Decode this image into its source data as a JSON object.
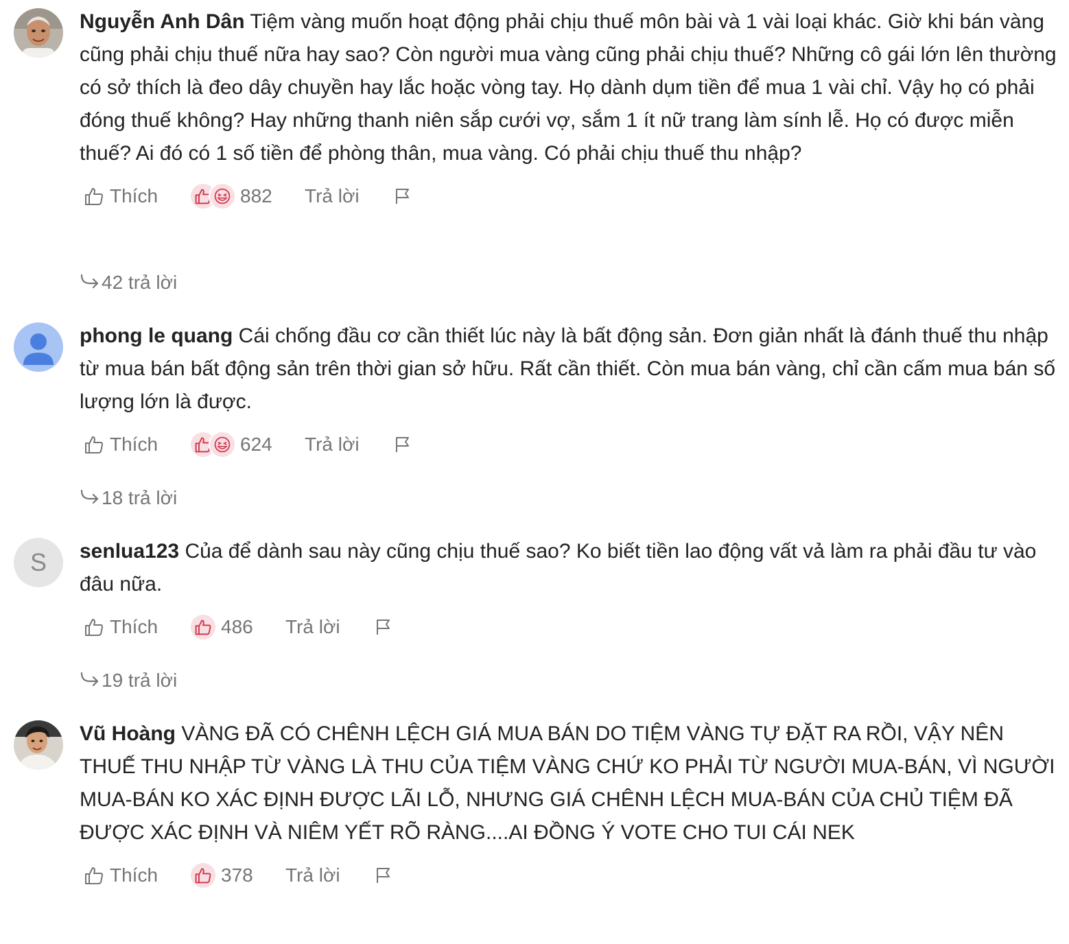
{
  "comments": [
    {
      "author": "Nguyễn Anh Dân",
      "avatar_type": "photo",
      "text": "Tiệm vàng muốn hoạt động phải chịu thuế môn bài và 1 vài loại khác. Giờ khi bán vàng cũng phải chịu thuế nữa hay sao? Còn người mua vàng cũng phải chịu thuế? Những cô gái lớn lên thường có sở thích là đeo dây chuyền hay lắc hoặc vòng tay. Họ dành dụm tiền để mua 1 vài chỉ. Vậy họ có phải đóng thuế không? Hay những thanh niên sắp cưới vợ, sắm 1 ít nữ trang làm sính lễ. Họ có được miễn thuế? Ai đó có 1 số tiền để phòng thân, mua vàng. Có phải chịu thuế thu nhập?",
      "like_label": "Thích",
      "reaction_icons": [
        "thumbs-up-icon",
        "laughing-face-icon"
      ],
      "reaction_count": "882",
      "reply_label": "Trả lời",
      "replies_label": "42 trả lời"
    },
    {
      "author": "phong le quang",
      "avatar_type": "default-user",
      "text": "Cái chống đầu cơ cần thiết lúc này là bất động sản. Đơn giản nhất là đánh thuế thu nhập từ mua bán bất động sản trên thời gian sở hữu. Rất cần thiết. Còn mua bán vàng, chỉ cần cấm mua bán số lượng lớn là được.",
      "like_label": "Thích",
      "reaction_icons": [
        "thumbs-up-icon",
        "laughing-face-icon"
      ],
      "reaction_count": "624",
      "reply_label": "Trả lời",
      "replies_label": "18 trả lời"
    },
    {
      "author": "senlua123",
      "avatar_type": "initial",
      "avatar_initial": "S",
      "text": "Của để dành sau này cũng chịu thuế sao? Ko biết tiền lao động vất vả làm ra phải đầu tư vào đâu nữa.",
      "like_label": "Thích",
      "reaction_icons": [
        "thumbs-up-icon"
      ],
      "reaction_count": "486",
      "reply_label": "Trả lời",
      "replies_label": "19 trả lời"
    },
    {
      "author": "Vũ Hoàng",
      "avatar_type": "photo",
      "text": "VÀNG ĐÃ CÓ CHÊNH LỆCH GIÁ MUA BÁN DO TIỆM VÀNG TỰ ĐẶT RA RỒI, VẬY NÊN THUẾ THU NHẬP TỪ VÀNG LÀ THU CỦA TIỆM VÀNG CHỨ KO PHẢI TỪ NGƯỜI MUA-BÁN, VÌ NGƯỜI MUA-BÁN KO XÁC ĐỊNH ĐƯỢC LÃI LỖ, NHƯNG GIÁ CHÊNH LỆCH MUA-BÁN CỦA CHỦ TIỆM ĐÃ ĐƯỢC XÁC ĐỊNH VÀ NIÊM YẾT RÕ RÀNG....AI ĐỒNG Ý VOTE CHO TUI CÁI NEK",
      "like_label": "Thích",
      "reaction_icons": [
        "thumbs-up-icon"
      ],
      "reaction_count": "378",
      "reply_label": "Trả lời"
    }
  ],
  "colors": {
    "text": "#222222",
    "muted": "#757575",
    "reaction_bg": "#f7dfe3",
    "reaction_icon": "#d0344a"
  }
}
